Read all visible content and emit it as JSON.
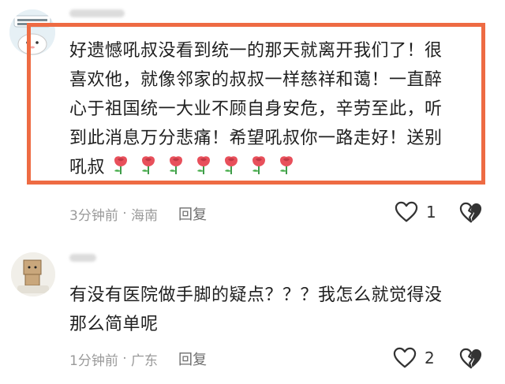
{
  "comments": [
    {
      "text": "好遗憾吼叔没看到统一的那天就离开我们了！很\n喜欢他，就像邻家的叔叔一样慈祥和蔼！一直醉\n心于祖国统一大业不顾自身安危，辛劳至此，听\n到此消息万分悲痛！希望吼叔你一路走好！送别\n吼叔",
      "time": "3分钟前",
      "location": "海南",
      "reply_label": "回复",
      "likes": "1",
      "rose_count": 7
    },
    {
      "text": "有没有医院做手脚的疑点？？？我怎么就觉得没\n那么简单呢",
      "time": "1分钟前",
      "location": "广东",
      "reply_label": "回复",
      "likes": "2"
    }
  ],
  "colors": {
    "highlight": "#ee6b43",
    "meta": "#9a9a9a",
    "rose": "#e8505b"
  },
  "icons": [
    "heart-outline-icon",
    "broken-heart-icon",
    "rose-icon"
  ]
}
